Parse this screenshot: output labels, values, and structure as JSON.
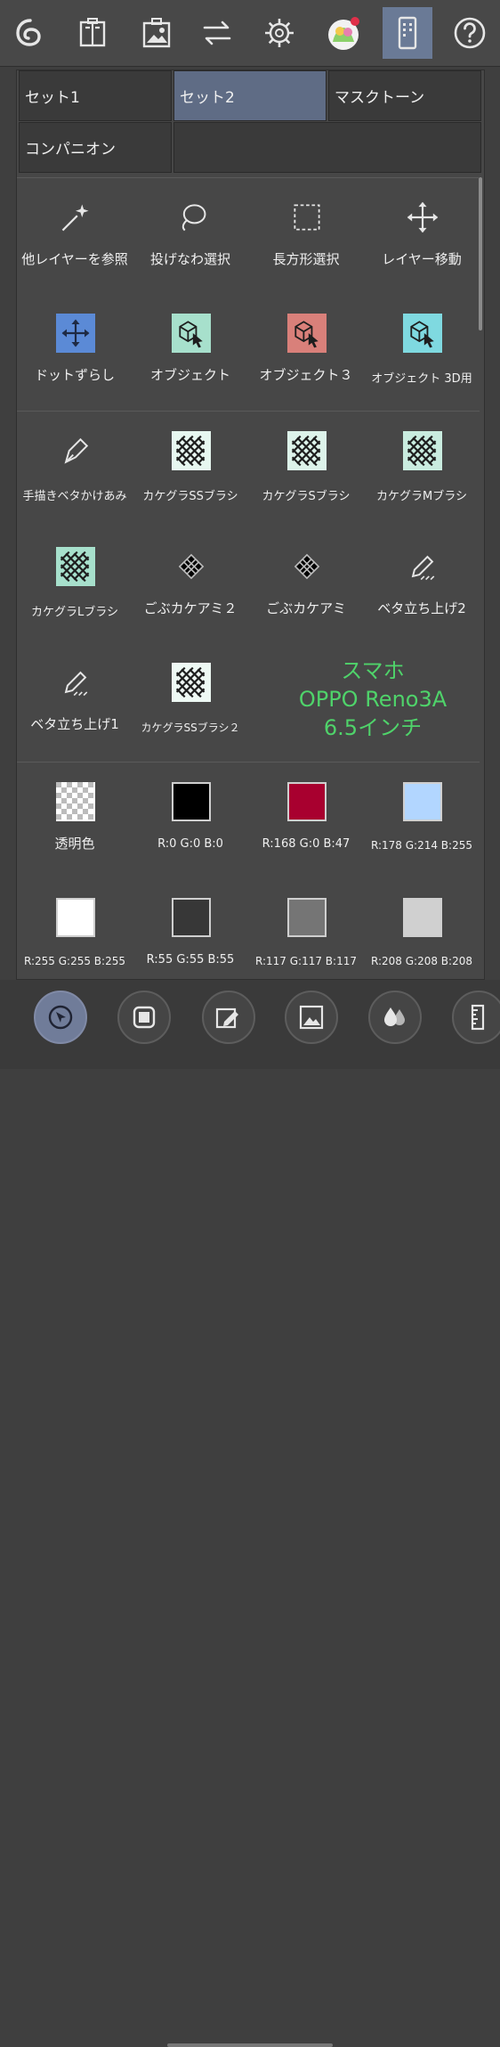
{
  "toolbar": {
    "buttons": [
      {
        "name": "clip-logo-icon"
      },
      {
        "name": "material-book-icon"
      },
      {
        "name": "image-material-icon"
      },
      {
        "name": "swap-arrows-icon"
      },
      {
        "name": "settings-gear-icon"
      },
      {
        "name": "avatar"
      },
      {
        "name": "phone-layout-icon",
        "active": true
      },
      {
        "name": "help-icon"
      }
    ]
  },
  "tabs": [
    "セット1",
    "セット2",
    "マスクトーン",
    "コンパニオン"
  ],
  "active_tab": "セット2",
  "tools_row1": [
    "他レイヤーを参照",
    "投げなわ選択",
    "長方形選択",
    "レイヤー移動"
  ],
  "tools_row2": [
    "ドットずらし",
    "オブジェクト",
    "オブジェクト３",
    "オブジェクト 3D用"
  ],
  "brushes_row1": [
    "手描きベタかけあみ",
    "カケグラSSブラシ",
    "カケグラSブラシ",
    "カケグラMブラシ"
  ],
  "brushes_row2": [
    "カケグラLブラシ",
    "ごぶカケアミ２",
    "ごぶカケアミ",
    "ベタ立ち上げ2"
  ],
  "brushes_row3": [
    "ベタ立ち上げ1",
    "カケグラSSブラシ２"
  ],
  "note": [
    "スマホ",
    "OPPO Reno3A",
    "6.5インチ"
  ],
  "colors_row1": [
    {
      "label": "透明色",
      "color": "transparent"
    },
    {
      "label": "R:0 G:0 B:0",
      "color": "#000000"
    },
    {
      "label": "R:168 G:0 B:47",
      "color": "#a8002f"
    },
    {
      "label": "R:178 G:214 B:255",
      "color": "#b2d6ff"
    }
  ],
  "colors_row2": [
    {
      "label": "R:255 G:255 B:255",
      "color": "#ffffff"
    },
    {
      "label": "R:55 G:55 B:55",
      "color": "#373737"
    },
    {
      "label": "R:117 G:117 B:117",
      "color": "#757575"
    },
    {
      "label": "R:208 G:208 B:208",
      "color": "#d0d0d0"
    }
  ],
  "bottom_buttons": [
    "select-tool-icon",
    "fill-square-icon",
    "pen-edit-icon",
    "image-frame-icon",
    "blend-drops-icon",
    "ruler-icon"
  ],
  "accent": {
    "active_tab": "#5f6c85",
    "note_text": "#4fd36a",
    "sub_tool_mint": "#a7e0cc",
    "sub_tool_red": "#d9807a",
    "sub_tool_cyan": "#7fd9e0",
    "sub_tool_blue": "#5b8ad6"
  }
}
